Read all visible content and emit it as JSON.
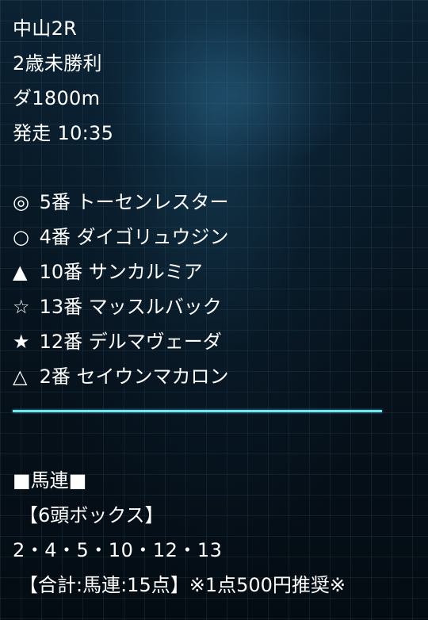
{
  "race": {
    "venue": "中山2R",
    "class": "2歳未勝利",
    "course": "ダ1800m",
    "start": "発走 10:35"
  },
  "picks": [
    {
      "mark": "◎",
      "text": "5番 トーセンレスター"
    },
    {
      "mark": "○",
      "text": "4番 ダイゴリュウジン"
    },
    {
      "mark": "▲",
      "text": "10番 サンカルミア"
    },
    {
      "mark": "☆",
      "text": "13番 マッスルバック"
    },
    {
      "mark": "★",
      "text": "12番 デルマヴェーダ"
    },
    {
      "mark": "△",
      "text": "2番 セイウンマカロン"
    }
  ],
  "bet": {
    "title": "■馬連■",
    "box": "【6頭ボックス】",
    "numbers": "2・4・5・10・12・13",
    "total": "【合計:馬連:15点】※1点500円推奨※"
  },
  "colors": {
    "accent": "#6fe6f0",
    "text": "#ffffff",
    "background": "#07131d"
  }
}
